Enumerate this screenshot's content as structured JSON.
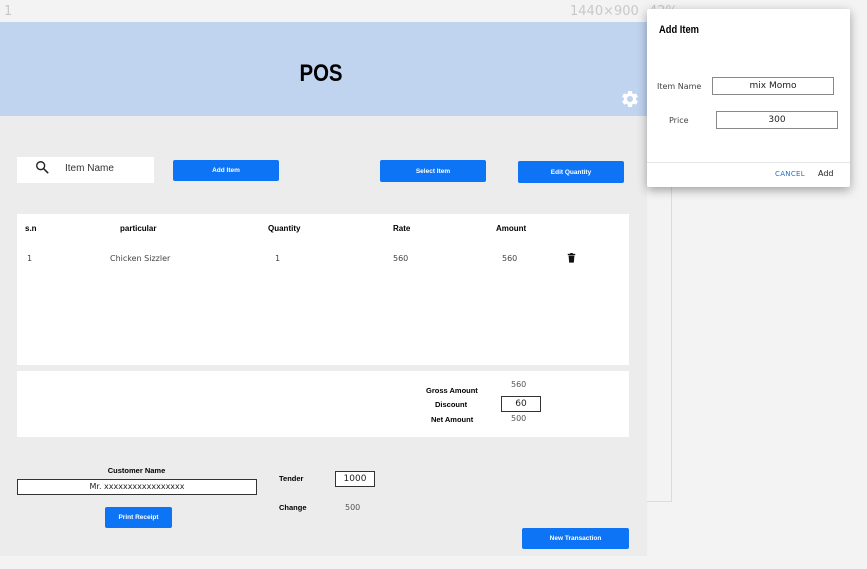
{
  "canvas": {
    "frame_number": "1",
    "dimensions": "1440×900",
    "zoom": "42%"
  },
  "app": {
    "title": "POS"
  },
  "toolbar": {
    "search_placeholder": "Item Name",
    "add_item": "Add Item",
    "select_item": "Select Item",
    "edit_quantity": "Edit Quantity"
  },
  "table": {
    "headers": {
      "sn": "s.n",
      "particular": "particular",
      "quantity": "Quantity",
      "rate": "Rate",
      "amount": "Amount"
    },
    "rows": [
      {
        "sn": "1",
        "particular": "Chicken Sizzler",
        "quantity": "1",
        "rate": "560",
        "amount": "560"
      }
    ]
  },
  "summary": {
    "gross_label": "Gross Amount",
    "gross_value": "560",
    "discount_label": "Discount",
    "discount_value": "60",
    "net_label": "Net Amount",
    "net_value": "500"
  },
  "checkout": {
    "customer_label": "Customer Name",
    "customer_value": "Mr. xxxxxxxxxxxxxxxxx",
    "tender_label": "Tender",
    "tender_value": "1000",
    "change_label": "Change",
    "change_value": "500",
    "print_receipt": "Print Receipt",
    "new_transaction": "New Transaction"
  },
  "dialog": {
    "title": "Add Item",
    "item_name_label": "Item Name",
    "item_name_value": "mix Momo",
    "price_label": "Price",
    "price_value": "300",
    "cancel": "CANCEL",
    "add": "Add"
  },
  "colors": {
    "header": "#c0d4f0",
    "primary_button": "#0d74f5",
    "cancel_link": "#1f6fd0"
  },
  "icons": {
    "settings": "gear-icon",
    "search": "search-icon",
    "delete": "trash-icon"
  }
}
